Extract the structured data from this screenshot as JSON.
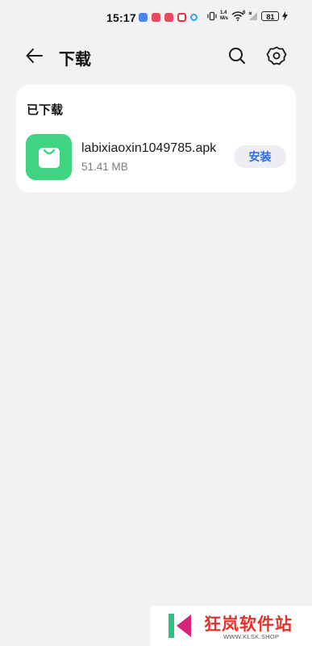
{
  "status_bar": {
    "time": "15:17",
    "net_speed_value": "1.4",
    "net_speed_unit": "M/s",
    "wifi_badge": "6",
    "battery": "81"
  },
  "header": {
    "title": "下载",
    "back_icon": "arrow-left-icon",
    "search_icon": "search-icon",
    "settings_icon": "gear-icon"
  },
  "downloaded": {
    "section_title": "已下载",
    "items": [
      {
        "file_name": "labixiaoxin1049785.apk",
        "file_size": "51.41 MB",
        "action_label": "安装",
        "icon": "shopping-bag-icon",
        "icon_color": "#3ed482"
      }
    ]
  },
  "watermark": {
    "name": "狂岚软件站",
    "url": "WWW.KLSK.SHOP"
  },
  "colors": {
    "background": "#f1f2f4",
    "accent": "#2f6bd8",
    "watermark_red": "#e0342b"
  }
}
